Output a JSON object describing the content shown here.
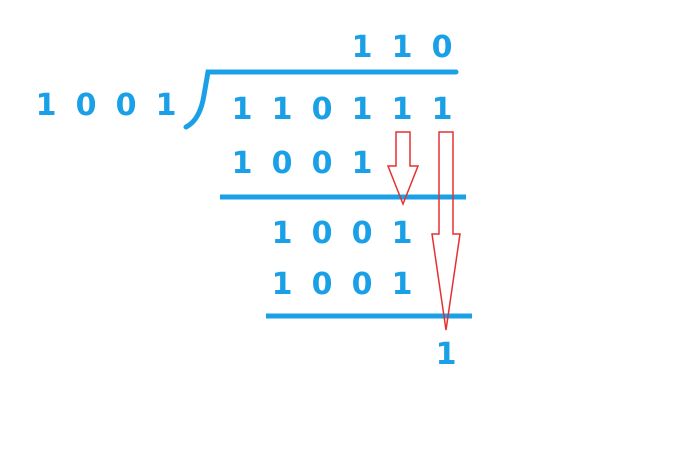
{
  "colors": {
    "digits": "#1aa0e6",
    "lines": "#1aa0e6",
    "arrows": "#e53030"
  },
  "quotient": [
    "1",
    "1",
    "0"
  ],
  "divisor": [
    "1",
    "0",
    "0",
    "1"
  ],
  "dividend": [
    "1",
    "1",
    "0",
    "1",
    "1",
    "1"
  ],
  "steps": [
    [
      "1",
      "0",
      "0",
      "1"
    ],
    [
      "1",
      "0",
      "0",
      "1"
    ],
    [
      "1",
      "0",
      "0",
      "1"
    ]
  ],
  "remainder": [
    "1"
  ]
}
